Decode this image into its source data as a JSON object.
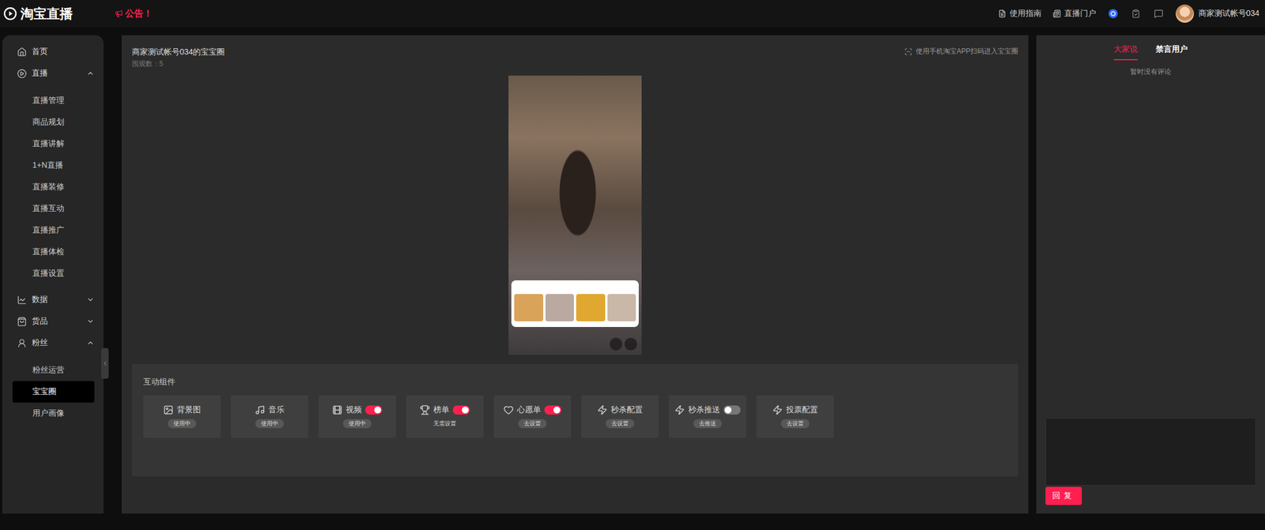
{
  "topbar": {
    "logo": "淘宝直播",
    "notice": "公告！",
    "links": [
      {
        "label": "使用指南"
      },
      {
        "label": "直播门户"
      }
    ],
    "account": "商家测试帐号034"
  },
  "sidebar": {
    "items": [
      {
        "label": "首页",
        "kind": "link",
        "expanded": false,
        "children": []
      },
      {
        "label": "直播",
        "kind": "group",
        "expanded": true,
        "children": [
          {
            "label": "直播管理",
            "selected": false
          },
          {
            "label": "商品规划",
            "selected": false
          },
          {
            "label": "直播讲解",
            "selected": false
          },
          {
            "label": "1+N直播",
            "selected": false
          },
          {
            "label": "直播装修",
            "selected": false
          },
          {
            "label": "直播互动",
            "selected": false
          },
          {
            "label": "直播推广",
            "selected": false
          },
          {
            "label": "直播体检",
            "selected": false
          },
          {
            "label": "直播设置",
            "selected": false
          }
        ]
      },
      {
        "label": "数据",
        "kind": "group",
        "expanded": false,
        "children": []
      },
      {
        "label": "货品",
        "kind": "group",
        "expanded": false,
        "children": []
      },
      {
        "label": "粉丝",
        "kind": "group",
        "expanded": true,
        "children": [
          {
            "label": "粉丝运营",
            "selected": false
          },
          {
            "label": "宝宝圈",
            "selected": true
          },
          {
            "label": "用户画像",
            "selected": false
          }
        ]
      }
    ]
  },
  "panel": {
    "title": "商家测试帐号034的宝宝圈",
    "viewers": "围观数：5",
    "scan_hint": "使用手机淘宝APP扫码进入宝宝圈"
  },
  "components": {
    "title": "互动组件",
    "items": [
      {
        "label": "背景图",
        "kind": "plain",
        "on": false,
        "status": "使用中",
        "pill": true
      },
      {
        "label": "音乐",
        "kind": "plain",
        "on": false,
        "status": "使用中",
        "pill": true
      },
      {
        "label": "视频",
        "kind": "toggle",
        "on": true,
        "status": "使用中",
        "pill": true
      },
      {
        "label": "榜单",
        "kind": "toggle",
        "on": true,
        "status": "无需设置",
        "pill": false
      },
      {
        "label": "心愿单",
        "kind": "toggle",
        "on": true,
        "status": "去设置",
        "pill": true
      },
      {
        "label": "秒杀配置",
        "kind": "plain",
        "on": false,
        "status": "去设置",
        "pill": true
      },
      {
        "label": "秒杀推送",
        "kind": "toggle",
        "on": false,
        "status": "去推送",
        "pill": true
      },
      {
        "label": "投票配置",
        "kind": "plain",
        "on": false,
        "status": "去设置",
        "pill": true
      }
    ]
  },
  "comments": {
    "tabs": [
      {
        "label": "大家说",
        "selected": true
      },
      {
        "label": "禁言用户",
        "selected": false
      }
    ],
    "empty": "暂时没有评论",
    "reply_button": "回复"
  }
}
